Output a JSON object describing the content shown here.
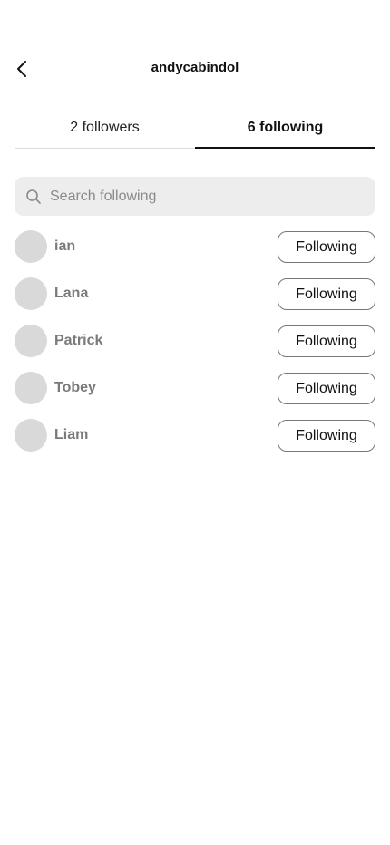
{
  "header": {
    "title": "andycabindol",
    "back_icon": "chevron-left-icon"
  },
  "tabs": [
    {
      "label": "2 followers",
      "active": false
    },
    {
      "label": "6 following",
      "active": true
    }
  ],
  "search": {
    "placeholder": "Search following",
    "value": "",
    "icon": "search-icon"
  },
  "list": [
    {
      "name": "ian",
      "button_label": "Following"
    },
    {
      "name": "Lana",
      "button_label": "Following"
    },
    {
      "name": "Patrick",
      "button_label": "Following"
    },
    {
      "name": "Tobey",
      "button_label": "Following"
    },
    {
      "name": "Liam",
      "button_label": "Following"
    }
  ],
  "colors": {
    "avatar_placeholder": "#d9d9d9",
    "search_background": "#ededed",
    "muted_name": "#7a7a7a",
    "active_tab_underline": "#111111"
  }
}
